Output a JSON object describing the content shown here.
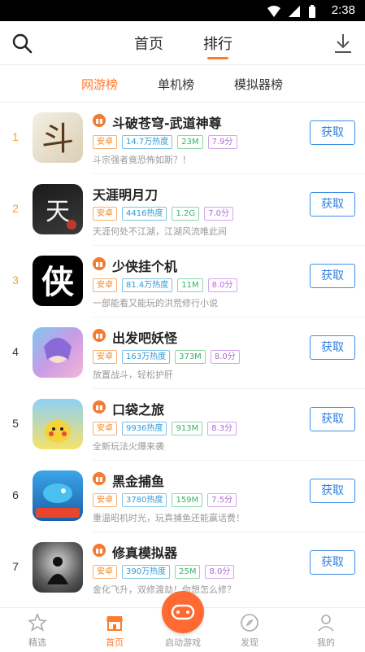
{
  "status_bar": {
    "time": "2:38"
  },
  "header": {
    "tabs": [
      {
        "label": "首页"
      },
      {
        "label": "排行"
      }
    ]
  },
  "subtabs": [
    {
      "label": "网游榜"
    },
    {
      "label": "单机榜"
    },
    {
      "label": "模拟器榜"
    }
  ],
  "get_label": "获取",
  "apps": [
    {
      "rank": "1",
      "name": "斗破苍穹-武道神尊",
      "platform": "安卓",
      "heat": "14.7万热度",
      "size": "23M",
      "score": "7.9分",
      "desc": "斗宗强者竟恐怖如斯？！",
      "gift": true
    },
    {
      "rank": "2",
      "name": "天涯明月刀",
      "platform": "安卓",
      "heat": "4416热度",
      "size": "1.2G",
      "score": "7.0分",
      "desc": "天涯何处不江湖，江湖风流唯此间",
      "gift": false
    },
    {
      "rank": "3",
      "name": "少侠挂个机",
      "platform": "安卓",
      "heat": "81.4万热度",
      "size": "11M",
      "score": "8.0分",
      "desc": "一部能看又能玩的洪荒修行小说",
      "gift": true
    },
    {
      "rank": "4",
      "name": "出发吧妖怪",
      "platform": "安卓",
      "heat": "163万热度",
      "size": "373M",
      "score": "8.0分",
      "desc": "放置战斗，轻松护肝",
      "gift": true
    },
    {
      "rank": "5",
      "name": "口袋之旅",
      "platform": "安卓",
      "heat": "9936热度",
      "size": "913M",
      "score": "8.3分",
      "desc": "全新玩法火爆来袭",
      "gift": true
    },
    {
      "rank": "6",
      "name": "黑金捕鱼",
      "platform": "安卓",
      "heat": "3780热度",
      "size": "159M",
      "score": "7.5分",
      "desc": "重温昭机时光，玩真捕鱼还能赢话费！",
      "gift": true
    },
    {
      "rank": "7",
      "name": "修真模拟器",
      "platform": "安卓",
      "heat": "390万热度",
      "size": "25M",
      "score": "8.0分",
      "desc": "金化飞升，双修渡劫！你想怎么修？",
      "gift": true
    }
  ],
  "bottom_nav": [
    {
      "label": "精选"
    },
    {
      "label": "首页"
    },
    {
      "label": "启动游戏"
    },
    {
      "label": "发现"
    },
    {
      "label": "我的"
    }
  ],
  "colors": {
    "accent": "#ff7a2f",
    "button": "#2f80e0",
    "gold_rank": "#f3a429"
  }
}
